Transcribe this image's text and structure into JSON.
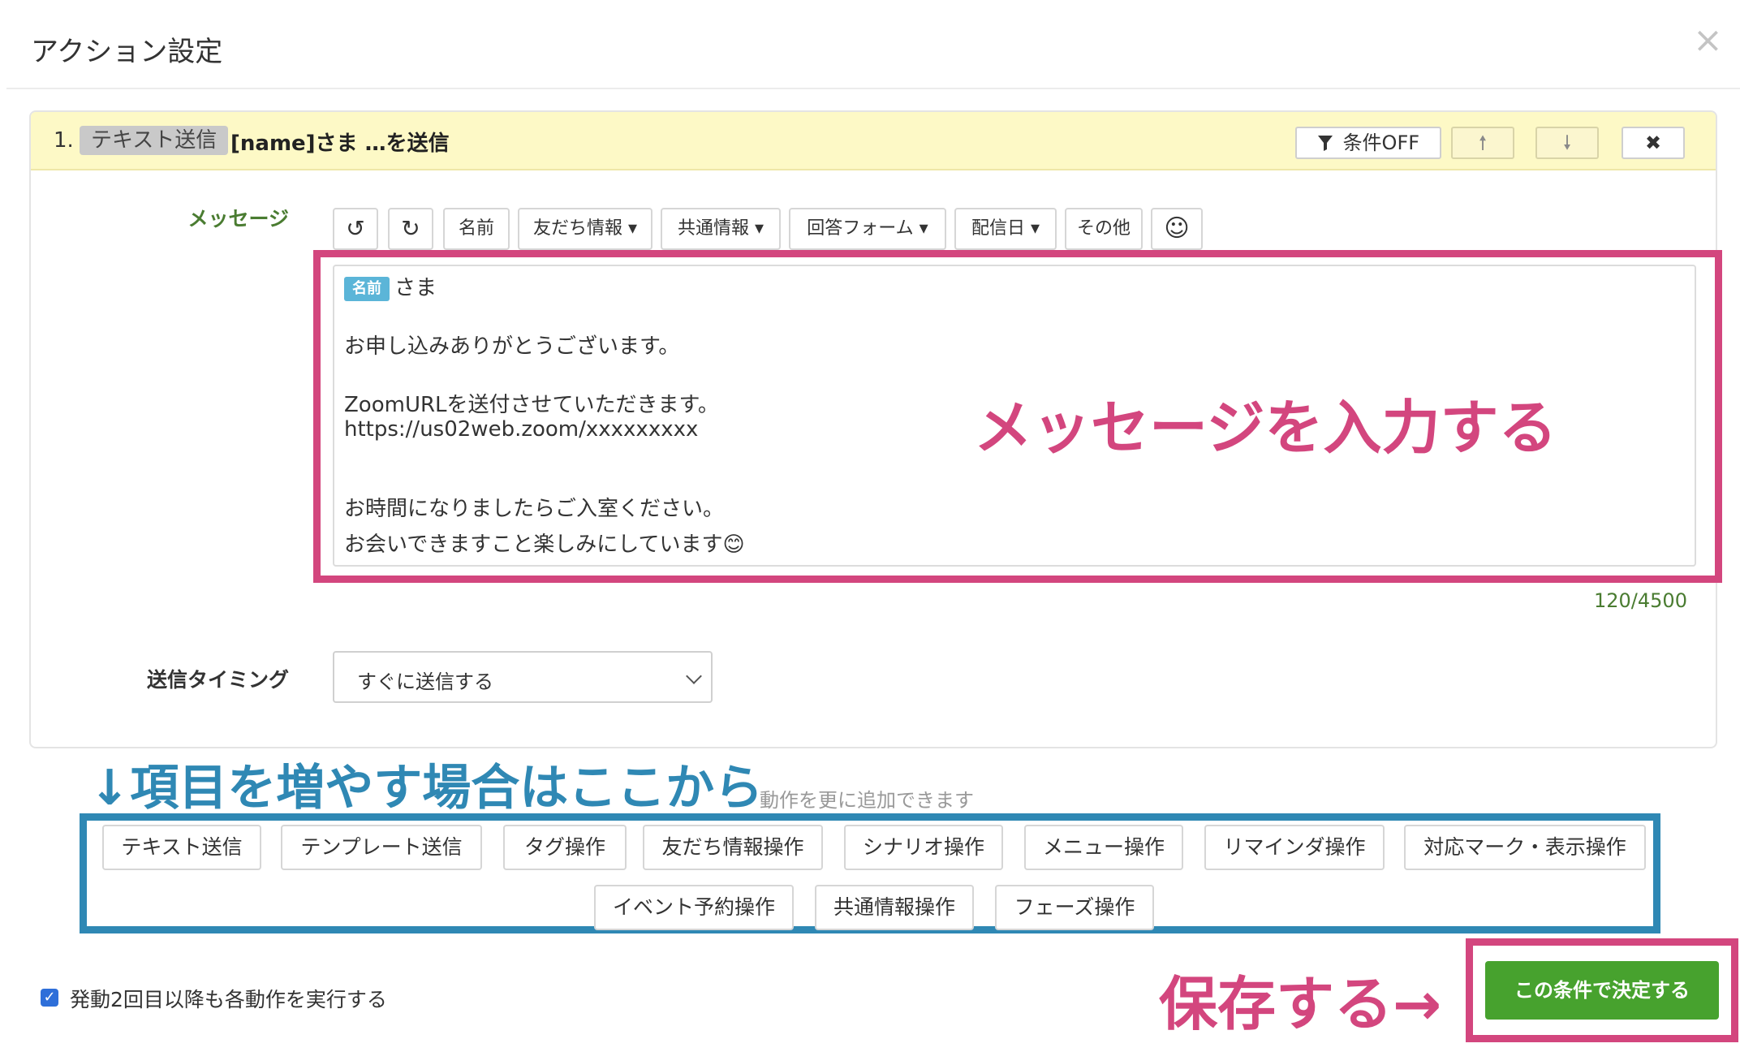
{
  "header": {
    "title": "アクション設定",
    "close_glyph": "×"
  },
  "action": {
    "step_number": "1.",
    "type_badge": "テキスト送信",
    "summary": "[name]さま …を送信",
    "condition_button": "条件OFF",
    "condition_icon": "filter-icon",
    "move_up_glyph": "🠕",
    "move_down_glyph": "🠗",
    "delete_glyph": "✖"
  },
  "message": {
    "label": "メッセージ",
    "toolbar": {
      "undo_glyph": "↺",
      "redo_glyph": "↻",
      "name": "名前",
      "friend_info": "友だち情報",
      "shared_info": "共通情報",
      "answer_form": "回答フォーム",
      "delivery_date": "配信日",
      "other": "その他",
      "emoji_glyph": "☺"
    },
    "editor": {
      "name_chip": "名前",
      "line1": "さま",
      "line2": "お申し込みありがとうございます。",
      "line3": "ZoomURLを送付させていただきます。",
      "line4": "https://us02web.zoom/xxxxxxxxx",
      "line5": "お時間になりましたらご入室ください。",
      "line6": "お会いできますこと楽しみにしています😊"
    },
    "counter": "120/4500"
  },
  "timing": {
    "label": "送信タイミング",
    "value": "すぐに送信する"
  },
  "annotations": {
    "message": "メッセージを入力する",
    "add": "↓項目を増やす場合はここから",
    "save": "保存する→"
  },
  "add_actions": {
    "hint": "動作を更に追加できます",
    "buttons": [
      "テキスト送信",
      "テンプレート送信",
      "タグ操作",
      "友だち情報操作",
      "シナリオ操作",
      "メニュー操作",
      "リマインダ操作",
      "対応マーク・表示操作",
      "イベント予約操作",
      "共通情報操作",
      "フェーズ操作"
    ]
  },
  "footer": {
    "repeat_checkbox_label": "発動2回目以降も各動作を実行する",
    "repeat_checked": true,
    "save_button": "この条件で決定する"
  },
  "colors": {
    "highlight_pink": "#d3467e",
    "highlight_blue": "#2f88b4",
    "save_green": "#47a22e",
    "header_yellow": "#fdf9c6"
  }
}
